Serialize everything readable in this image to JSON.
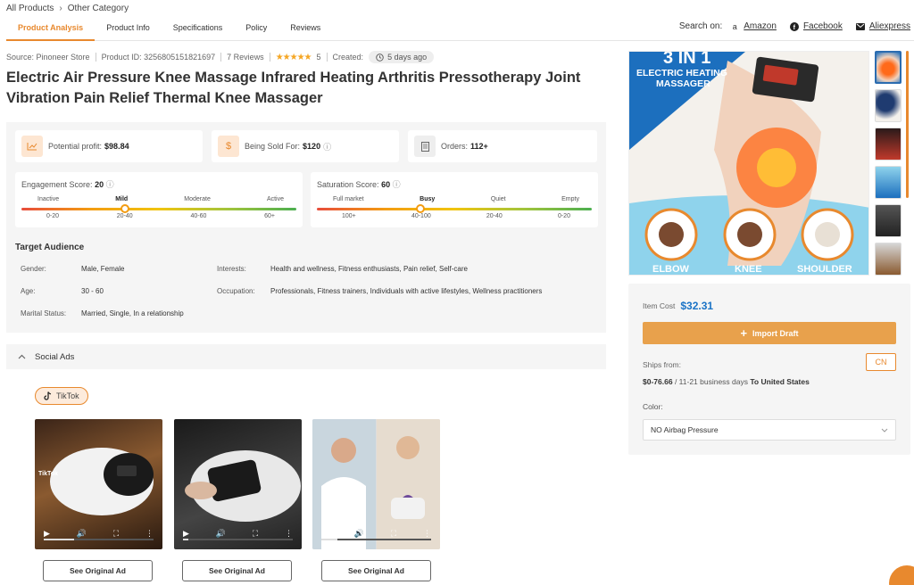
{
  "breadcrumb": {
    "all": "All Products",
    "separator": "›",
    "category": "Other Category"
  },
  "tabs": [
    {
      "label": "Product Analysis",
      "active": true
    },
    {
      "label": "Product Info"
    },
    {
      "label": "Specifications"
    },
    {
      "label": "Policy"
    },
    {
      "label": "Reviews"
    }
  ],
  "search_on": {
    "label": "Search on:",
    "links": [
      {
        "icon": "amazon-icon",
        "label": "Amazon"
      },
      {
        "icon": "facebook-icon",
        "label": "Facebook"
      },
      {
        "icon": "mail-icon",
        "label": "Aliexpress"
      }
    ]
  },
  "meta": {
    "source": "Source: Pinoneer Store",
    "product_id": "Product ID: 3256805151821697",
    "reviews": "7 Reviews",
    "stars": "★★★★★",
    "rating": "5",
    "created_label": "Created:",
    "created_value": "5 days ago"
  },
  "title": "Electric Air Pressure Knee Massage Infrared Heating Arthritis Pressotherapy Joint Vibration Pain Relief Thermal Knee Massager",
  "stats": {
    "profit_label": "Potential profit:",
    "profit_value": "$98.84",
    "sold_label": "Being Sold For:",
    "sold_value": "$120",
    "orders_label": "Orders:",
    "orders_value": "112+"
  },
  "engagement": {
    "label": "Engagement Score:",
    "value": "20",
    "level": 0.375,
    "levels": [
      "Inactive",
      "Mild",
      "Moderate",
      "Active"
    ],
    "ranges": [
      "0-20",
      "20-40",
      "40-60",
      "60+"
    ]
  },
  "saturation": {
    "label": "Saturation Score:",
    "value": "60",
    "level": 0.375,
    "levels": [
      "Full market",
      "Busy",
      "Quiet",
      "Empty"
    ],
    "ranges": [
      "100+",
      "40-100",
      "20-40",
      "0-20"
    ]
  },
  "audience": {
    "title": "Target Audience",
    "gender_label": "Gender:",
    "gender_value": "Male, Female",
    "age_label": "Age:",
    "age_value": "30 - 60",
    "marital_label": "Marital Status:",
    "marital_value": "Married, Single, In a relationship",
    "interests_label": "Interests:",
    "interests_value": "Health and wellness, Fitness enthusiasts, Pain relief, Self-care",
    "occupation_label": "Occupation:",
    "occupation_value": "Professionals, Fitness trainers, Individuals with active lifestyles, Wellness practitioners"
  },
  "social": {
    "title": "Social Ads",
    "platform": "TikTok",
    "video_caption": "TikTok",
    "videos": [
      {
        "progress": 0.28
      },
      {
        "progress": 0.05
      },
      {
        "progress": 0.15
      }
    ],
    "see_label": "See Original Ad"
  },
  "hero": {
    "headline": "3 IN 1",
    "subheadline_1": "ELECTRIC HEATING",
    "subheadline_2": "MASSAGER",
    "label_1": "ELBOW",
    "label_2": "KNEE",
    "label_3": "SHOULDER"
  },
  "purchase": {
    "cost_label": "Item Cost",
    "cost_value": "$32.31",
    "import_label": "Import Draft",
    "ships_from": "Ships from:",
    "origin": "CN",
    "ship_price": "$0-76.66",
    "ship_days": "/ 11-21 business days",
    "ship_dest": "To United States",
    "color_label": "Color:",
    "color_value": "NO Airbag Pressure"
  },
  "colors": {
    "accent": "#e8892e",
    "link": "#1a73c6"
  }
}
